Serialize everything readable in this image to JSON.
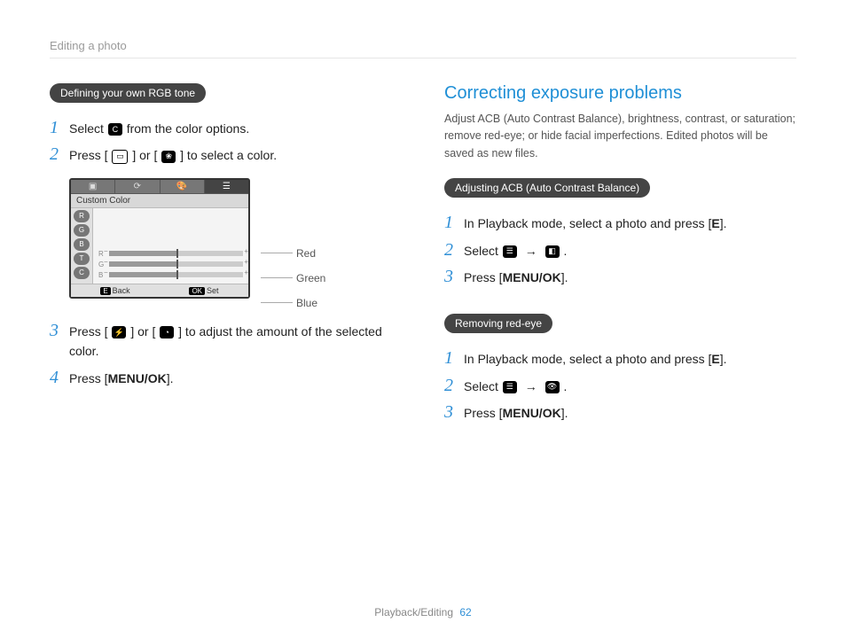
{
  "header": "Editing a photo",
  "left": {
    "pill": "Defining your own RGB tone",
    "step1_pre": "Select ",
    "step1_post": " from the color options.",
    "step2_pre": "Press [",
    "step2_mid": "] or [",
    "step2_post": "] to select a color.",
    "lcd_label": "Custom Color",
    "slider_r": "R",
    "slider_g": "G",
    "slider_b": "B",
    "bk_key": "E",
    "bk_lbl": "Back",
    "set_key": "OK",
    "set_lbl": "Set",
    "call_red": "Red",
    "call_green": "Green",
    "call_blue": "Blue",
    "step3_pre": "Press [",
    "step3_mid": "] or [",
    "step3_post": "] to adjust the amount of the selected color.",
    "step4_pre": "Press [",
    "step4_key": "MENU/OK",
    "step4_post": "]."
  },
  "right": {
    "h2": "Correcting exposure problems",
    "lead": "Adjust ACB (Auto Contrast Balance), brightness, contrast, or saturation; remove red-eye; or hide facial imperfections. Edited photos will be saved as new files.",
    "pill_acb": "Adjusting ACB (Auto Contrast Balance)",
    "acb_s1_pre": "In Playback mode, select a photo and press [",
    "acb_s1_key": "E",
    "acb_s1_post": "].",
    "acb_s2_pre": "Select ",
    "acb_s2_post": ".",
    "acb_s3_pre": "Press [",
    "acb_s3_key": "MENU/OK",
    "acb_s3_post": "].",
    "pill_red": "Removing red-eye",
    "red_s1_pre": "In Playback mode, select a photo and press [",
    "red_s1_key": "E",
    "red_s1_post": "].",
    "red_s2_pre": "Select ",
    "red_s2_post": ".",
    "red_s3_pre": "Press [",
    "red_s3_key": "MENU/OK",
    "red_s3_post": "]."
  },
  "footer_label": "Playback/Editing",
  "footer_page": "62"
}
